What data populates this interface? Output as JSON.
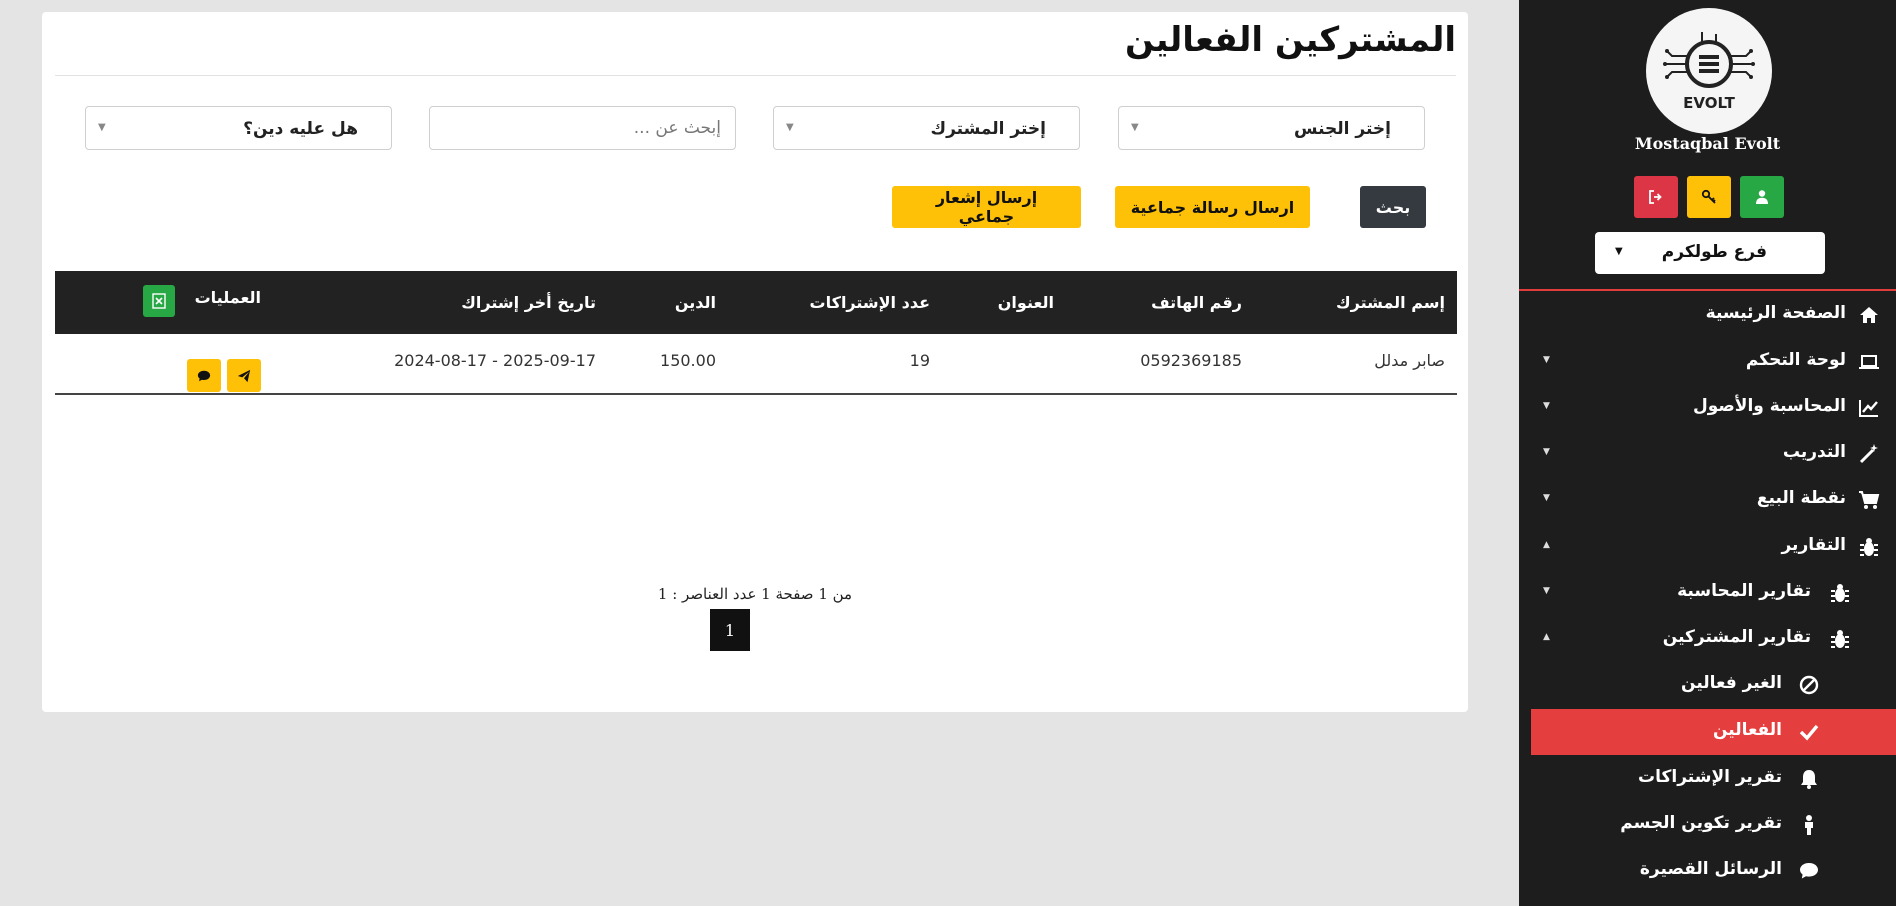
{
  "page": {
    "title": "المشتركين الفعالين"
  },
  "filters": {
    "gender": "إختر الجنس",
    "subscriber": "إختر المشترك",
    "search_placeholder": "إبحث عن ...",
    "debt": "هل عليه دين؟"
  },
  "actions": {
    "search": "بحث",
    "group_message": "ارسال رسالة جماعية",
    "group_notification": "إرسال إشعار جماعي"
  },
  "table": {
    "headers": {
      "name": "إسم المشترك",
      "phone": "رقم الهاتف",
      "address": "العنوان",
      "subs_count": "عدد الإشتراكات",
      "debt": "الدين",
      "last_sub_date": "تاريخ أخر إشتراك",
      "operations": "العمليات"
    },
    "rows": [
      {
        "name": "صابر مدلل",
        "phone": "0592369185",
        "address": "",
        "subs_count": "19",
        "debt": "150.00",
        "last_sub_date": "2024-08-17 - 2025-09-17"
      }
    ]
  },
  "pagination": {
    "info": "من 1 صفحة 1 عدد العناصر : 1",
    "current_page": "1"
  },
  "sidebar": {
    "brand": "Mostaqbal Evolt",
    "logo_text": "EVOLT",
    "branch": "فرع طولكرم",
    "items": [
      {
        "label": "الصفحة الرئيسية",
        "icon": "home-icon"
      },
      {
        "label": "لوحة التحكم",
        "icon": "laptop-icon"
      },
      {
        "label": "المحاسبة والأصول",
        "icon": "chart-line-icon"
      },
      {
        "label": "التدريب",
        "icon": "magic-wand-icon"
      },
      {
        "label": "نقطة البيع",
        "icon": "cart-icon"
      },
      {
        "label": "التقارير",
        "icon": "bug-icon"
      },
      {
        "label": "تقارير المحاسبة",
        "icon": "bug-icon"
      },
      {
        "label": "تقارير المشتركين",
        "icon": "bug-icon"
      },
      {
        "label": "الغير فعالين",
        "icon": "ban-icon"
      },
      {
        "label": "الفعالين",
        "icon": "check-icon"
      },
      {
        "label": "تقرير الإشتراكات",
        "icon": "bell-icon"
      },
      {
        "label": "تقرير تكوين الجسم",
        "icon": "person-icon"
      },
      {
        "label": "الرسائل القصيرة",
        "icon": "comment-icon"
      }
    ]
  },
  "colors": {
    "sidebar_bg": "#1d1d1d",
    "accent_red": "#e53e3e",
    "accent_yellow": "#ffc107",
    "accent_green": "#28a745",
    "table_header": "#222222"
  }
}
